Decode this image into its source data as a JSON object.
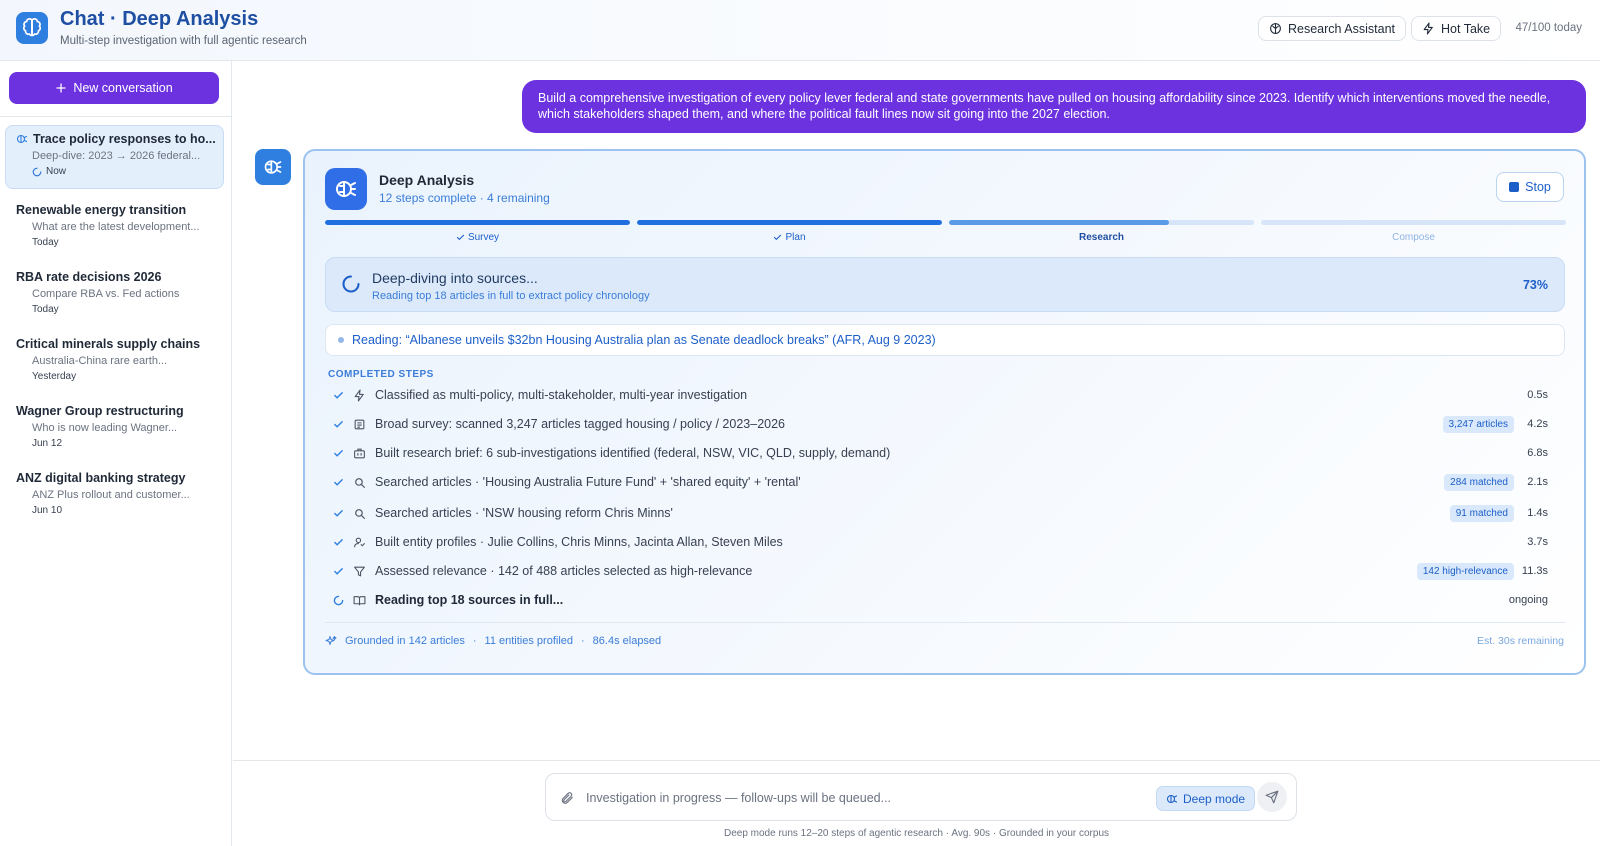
{
  "header": {
    "title": "Chat · Deep Analysis",
    "subtitle": "Multi-step investigation with full agentic research",
    "research_assistant": "Research Assistant",
    "hot_take": "Hot Take",
    "quota": "47/100 today"
  },
  "sidebar": {
    "new_conversation": "New conversation",
    "items": [
      {
        "title": "Trace policy responses to ho...",
        "snippet": "Deep-dive: 2023 → 2026 federal...",
        "time": "Now"
      },
      {
        "title": "Renewable energy transition",
        "snippet": "What are the latest development...",
        "time": "Today"
      },
      {
        "title": "RBA rate decisions 2026",
        "snippet": "Compare RBA vs. Fed actions",
        "time": "Today"
      },
      {
        "title": "Critical minerals supply chains",
        "snippet": "Australia-China rare earth...",
        "time": "Yesterday"
      },
      {
        "title": "Wagner Group restructuring",
        "snippet": "Who is now leading Wagner...",
        "time": "Jun 12"
      },
      {
        "title": "ANZ digital banking strategy",
        "snippet": "ANZ Plus rollout and customer...",
        "time": "Jun 10"
      }
    ]
  },
  "user_message": "Build a comprehensive investigation of every policy lever federal and state governments have pulled on housing affordability since 2023. Identify which interventions moved the needle, which stakeholders shaped them, and where the political fault lines now sit going into the 2027 election.",
  "card": {
    "title": "Deep Analysis",
    "subtitle": "12 steps complete · 4 remaining",
    "stop": "Stop",
    "phases": [
      {
        "label": "Survey",
        "progress": 1.0,
        "state": "done"
      },
      {
        "label": "Plan",
        "progress": 1.0,
        "state": "done"
      },
      {
        "label": "Research",
        "progress": 0.72,
        "state": "active"
      },
      {
        "label": "Compose",
        "progress": 0.0,
        "state": "pending"
      }
    ],
    "status": {
      "title": "Deep-diving into sources...",
      "subtitle": "Reading top 18 articles in full to extract policy chronology",
      "percent": "73%"
    },
    "reading": "Reading: “Albanese unveils $32bn Housing Australia plan as Senate deadlock breaks” (AFR, Aug 9 2023)",
    "steps_heading": "COMPLETED STEPS",
    "steps": [
      {
        "icon": "bolt-icon",
        "text": "Classified as multi-policy, multi-stakeholder, multi-year investigation",
        "badge": "",
        "duration": "0.5s",
        "state": "done"
      },
      {
        "icon": "newspaper-icon",
        "text": "Broad survey: scanned 3,247 articles tagged housing / policy / 2023–2026",
        "badge": "3,247 articles",
        "duration": "4.2s",
        "state": "done"
      },
      {
        "icon": "briefcase-icon",
        "text": "Built research brief: 6 sub-investigations identified (federal, NSW, VIC, QLD, supply, demand)",
        "badge": "",
        "duration": "6.8s",
        "state": "done"
      },
      {
        "icon": "search-icon",
        "text": "Searched articles · 'Housing Australia Future Fund' + 'shared equity' + 'rental'",
        "badge": "284 matched",
        "duration": "2.1s",
        "state": "done"
      },
      {
        "icon": "search-icon",
        "text": "Searched articles · 'NSW housing reform Chris Minns'",
        "badge": "91 matched",
        "duration": "1.4s",
        "state": "done"
      },
      {
        "icon": "users-icon",
        "text": "Built entity profiles · Julie Collins, Chris Minns, Jacinta Allan, Steven Miles",
        "badge": "",
        "duration": "3.7s",
        "state": "done"
      },
      {
        "icon": "filter-icon",
        "text": "Assessed relevance · 142 of 488 articles selected as high-relevance",
        "badge": "142 high-relevance",
        "duration": "11.3s",
        "state": "done"
      },
      {
        "icon": "book-icon",
        "text": "Reading top 18 sources in full...",
        "badge": "",
        "duration": "ongoing",
        "state": "active"
      }
    ],
    "footer": {
      "grounded": "Grounded in 142 articles",
      "entities": "11 entities profiled",
      "elapsed": "86.4s elapsed",
      "separator": "·",
      "estimate": "Est. 30s remaining"
    }
  },
  "composer": {
    "placeholder": "Investigation in progress — follow-ups will be queued...",
    "deep_mode": "Deep mode",
    "footnote": "Deep mode runs 12–20 steps of agentic research · Avg. 90s · Grounded in your corpus"
  },
  "colors": {
    "accent_purple": "#6d32e0",
    "accent_blue": "#1d5fc9",
    "brand_blue": "#2f7fe0"
  }
}
